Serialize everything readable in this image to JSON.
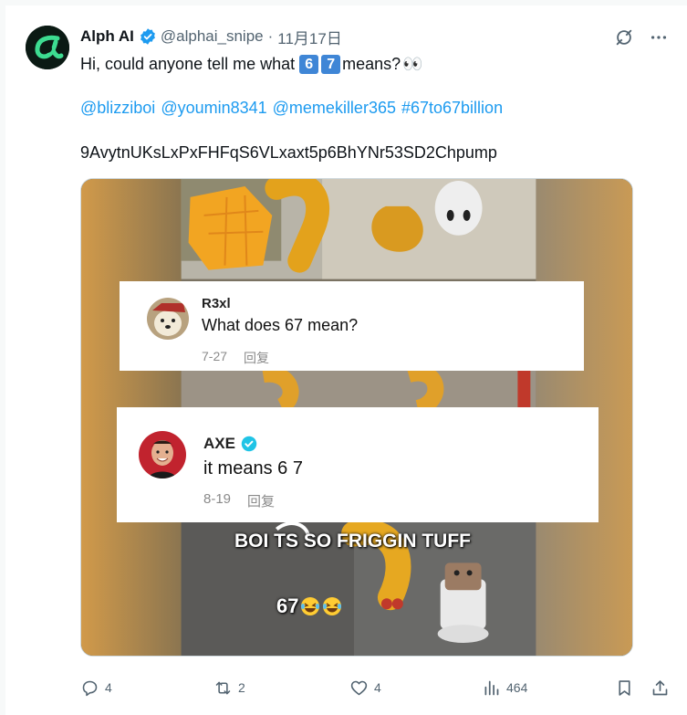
{
  "tweet": {
    "display_name": "Alph AI",
    "handle": "@alphai_snipe",
    "separator": "·",
    "date": "11月17日",
    "text_prefix": "Hi, could anyone tell me what",
    "key6": "6",
    "key7": "7",
    "text_suffix": "means?",
    "eyes_emoji": "👀",
    "mentions": [
      "@blizziboi",
      "@youmin8341",
      "@memekiller365",
      "#67to67billion"
    ],
    "contract_address": "9AvytnUKsLxPxFHFqS6VLxaxt5p6BhYNr53SD2Chpump"
  },
  "media": {
    "comment1": {
      "name": "R3xl",
      "text": "What does 67 mean?",
      "date": "7-27",
      "reply": "回复"
    },
    "comment2": {
      "name": "AXE",
      "text": "it means 6 7",
      "date": "8-19",
      "reply": "回复"
    },
    "caption": "BOI TS SO FRIGGIN TUFF",
    "caption2": "67"
  },
  "actions": {
    "replies": "4",
    "reposts": "2",
    "likes": "4",
    "views": "464"
  },
  "colors": {
    "link": "#1d9bf0",
    "secondary_text": "#536471",
    "verified": "#1d9bf0",
    "keycap": "#3f86d6"
  }
}
